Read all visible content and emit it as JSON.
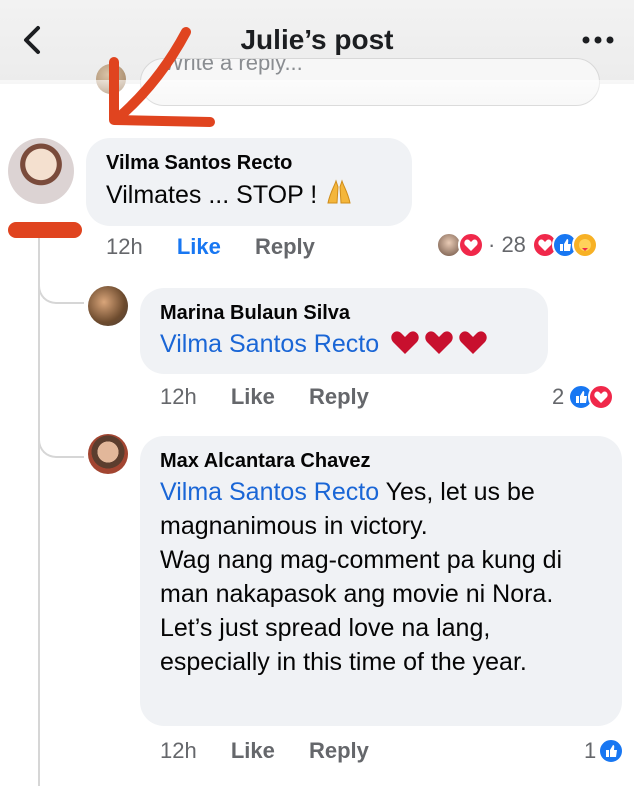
{
  "header": {
    "title": "Julie’s post"
  },
  "reply_box": {
    "placeholder": "Write a reply..."
  },
  "comment": {
    "author": "Vilma Santos Recto",
    "text": "Vilmates ... STOP ! ",
    "time": "12h",
    "like_label": "Like",
    "reply_label": "Reply",
    "reaction_count": "· 28"
  },
  "replies": [
    {
      "author": "Marina Bulaun Silva",
      "mention": "Vilma Santos Recto",
      "text": "",
      "time": "12h",
      "like_label": "Like",
      "reply_label": "Reply",
      "reaction_count": "2"
    },
    {
      "author": "Max Alcantara Chavez",
      "mention": "Vilma Santos Recto",
      "text": " Yes, let us be magnanimous in victory.",
      "text2": "Wag nang mag-comment pa kung di man nakapasok ang movie ni Nora.  Let’s just spread love na lang, especially in this time of the year.",
      "time": "12h",
      "like_label": "Like",
      "reply_label": "Reply",
      "reaction_count": "1"
    }
  ],
  "colors": {
    "accent": "#1877f2",
    "annotation": "#e0441f"
  }
}
